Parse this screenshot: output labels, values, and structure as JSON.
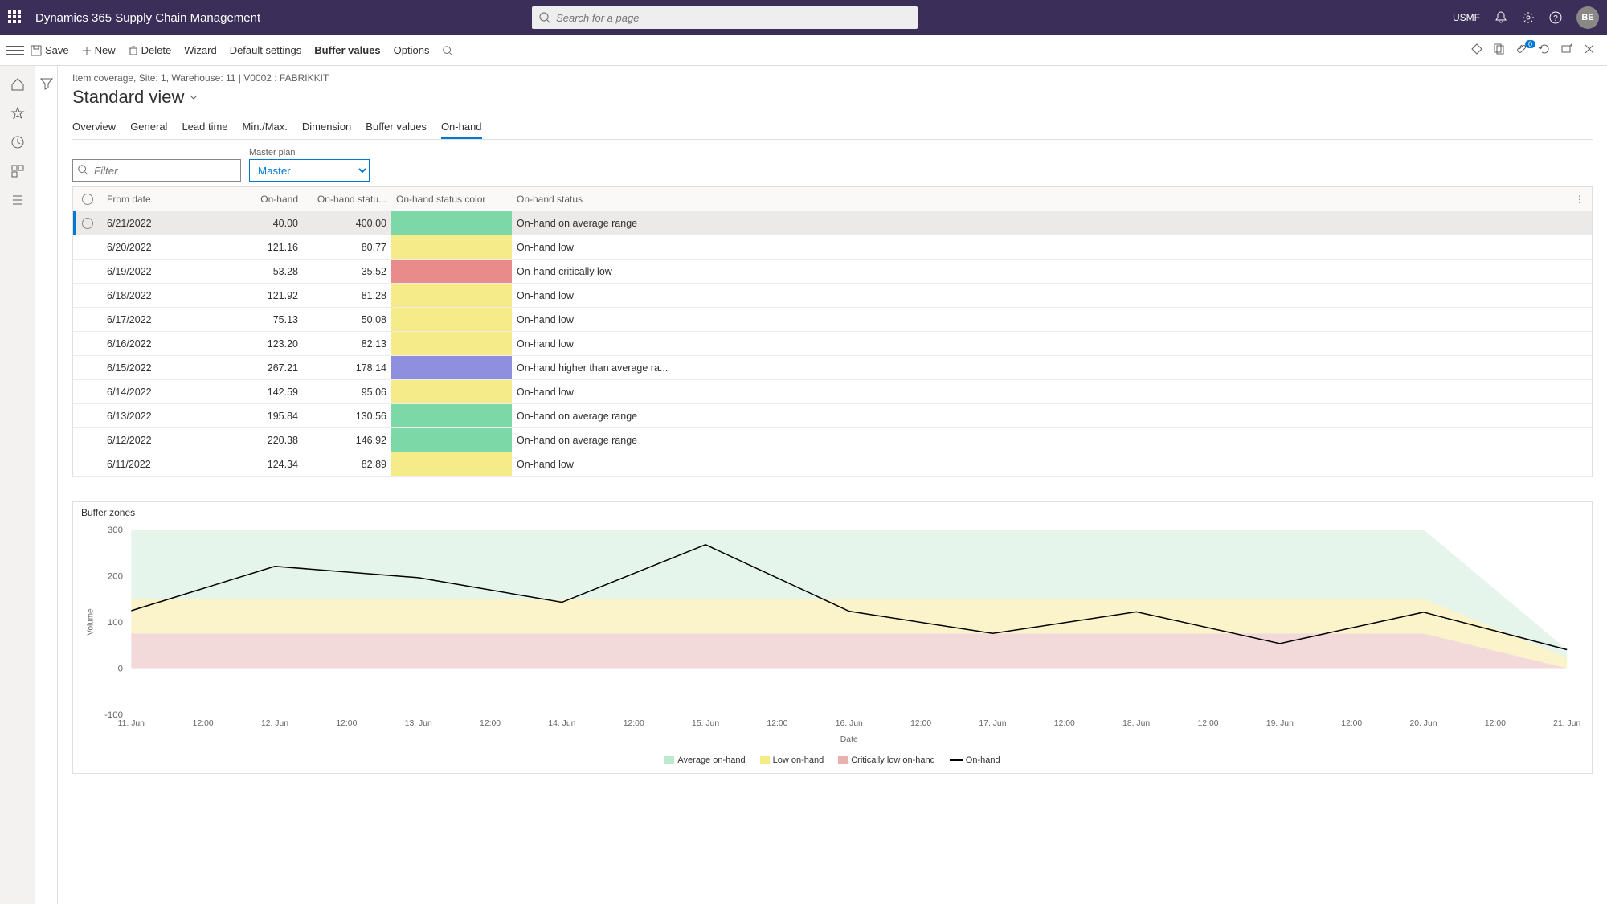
{
  "header": {
    "app_title": "Dynamics 365 Supply Chain Management",
    "search_placeholder": "Search for a page",
    "company": "USMF",
    "avatar_initials": "BE"
  },
  "commandbar": {
    "save": "Save",
    "new": "New",
    "delete": "Delete",
    "wizard": "Wizard",
    "defaults": "Default settings",
    "buffer": "Buffer values",
    "options": "Options",
    "attach_count": "0"
  },
  "breadcrumb": "Item coverage, Site: 1, Warehouse: 11   |   V0002 : FABRIKKIT",
  "view_title": "Standard view",
  "tabs": {
    "overview": "Overview",
    "general": "General",
    "lead": "Lead time",
    "minmax": "Min./Max.",
    "dimension": "Dimension",
    "buffer": "Buffer values",
    "onhand": "On-hand"
  },
  "filters": {
    "filter_placeholder": "Filter",
    "mp_label": "Master plan",
    "mp_value": "Master"
  },
  "columns": {
    "from_date": "From date",
    "onhand": "On-hand",
    "onhand_status_pct": "On-hand statu...",
    "onhand_status_color": "On-hand status color",
    "onhand_status": "On-hand status"
  },
  "rows": [
    {
      "date": "6/21/2022",
      "onhand": "40.00",
      "pct": "400.00",
      "color": "green",
      "status": "On-hand on average range",
      "selected": true
    },
    {
      "date": "6/20/2022",
      "onhand": "121.16",
      "pct": "80.77",
      "color": "yellow",
      "status": "On-hand low"
    },
    {
      "date": "6/19/2022",
      "onhand": "53.28",
      "pct": "35.52",
      "color": "red",
      "status": "On-hand critically low"
    },
    {
      "date": "6/18/2022",
      "onhand": "121.92",
      "pct": "81.28",
      "color": "yellow",
      "status": "On-hand low"
    },
    {
      "date": "6/17/2022",
      "onhand": "75.13",
      "pct": "50.08",
      "color": "yellow",
      "status": "On-hand low"
    },
    {
      "date": "6/16/2022",
      "onhand": "123.20",
      "pct": "82.13",
      "color": "yellow",
      "status": "On-hand low"
    },
    {
      "date": "6/15/2022",
      "onhand": "267.21",
      "pct": "178.14",
      "color": "blue",
      "status": "On-hand higher than average ra..."
    },
    {
      "date": "6/14/2022",
      "onhand": "142.59",
      "pct": "95.06",
      "color": "yellow",
      "status": "On-hand low"
    },
    {
      "date": "6/13/2022",
      "onhand": "195.84",
      "pct": "130.56",
      "color": "green",
      "status": "On-hand on average range"
    },
    {
      "date": "6/12/2022",
      "onhand": "220.38",
      "pct": "146.92",
      "color": "green",
      "status": "On-hand on average range"
    },
    {
      "date": "6/11/2022",
      "onhand": "124.34",
      "pct": "82.89",
      "color": "yellow",
      "status": "On-hand low"
    }
  ],
  "chart_data": {
    "type": "line",
    "title": "Buffer zones",
    "xlabel": "Date",
    "ylabel": "Volume",
    "ylim": [
      -100,
      300
    ],
    "categories": [
      "11. Jun",
      "12:00",
      "12. Jun",
      "12:00",
      "13. Jun",
      "12:00",
      "14. Jun",
      "12:00",
      "15. Jun",
      "12:00",
      "16. Jun",
      "12:00",
      "17. Jun",
      "12:00",
      "18. Jun",
      "12:00",
      "19. Jun",
      "12:00",
      "20. Jun",
      "12:00",
      "21. Jun"
    ],
    "x_days": [
      "6/11",
      "6/12",
      "6/13",
      "6/14",
      "6/15",
      "6/16",
      "6/17",
      "6/18",
      "6/19",
      "6/20",
      "6/21"
    ],
    "series": [
      {
        "name": "On-hand",
        "values": [
          124.34,
          220.38,
          195.84,
          142.59,
          267.21,
          123.2,
          75.13,
          121.92,
          53.28,
          121.16,
          40.0
        ]
      }
    ],
    "bands": {
      "average_top": 300,
      "average_bottom": 150,
      "low_bottom": 75,
      "critical_bottom": 0
    },
    "legend": {
      "avg": "Average on-hand",
      "low": "Low on-hand",
      "crit": "Critically low on-hand",
      "onh": "On-hand"
    }
  }
}
